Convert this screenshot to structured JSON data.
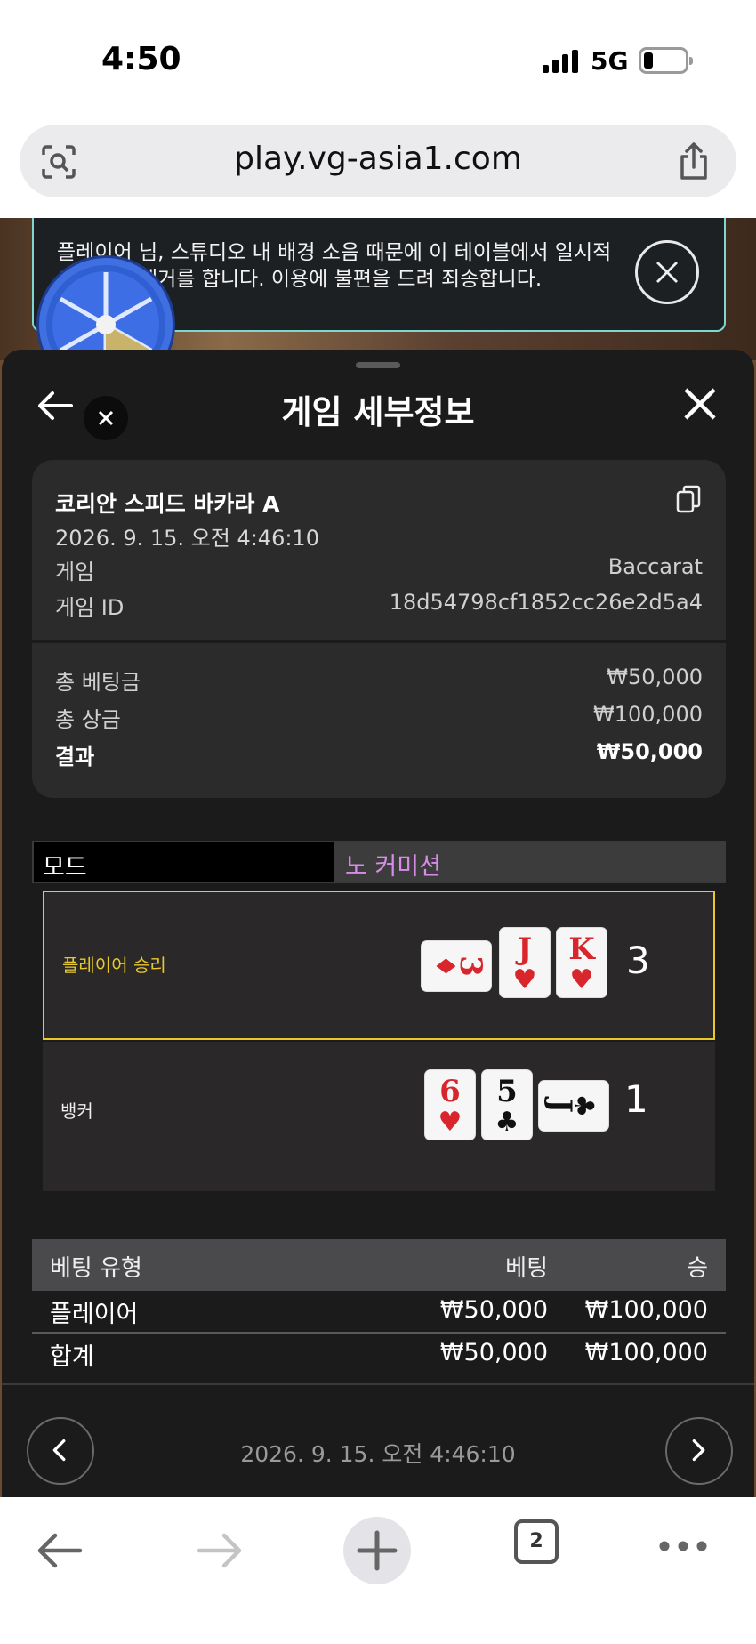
{
  "status_bar": {
    "time": "4:50",
    "network": "5G"
  },
  "browser": {
    "url": "play.vg-asia1.com",
    "tab_count": "2"
  },
  "notice": {
    "text": "플레이어 님, 스튜디오 내 배경 소음 때문에 이 테이블에서 일시적으로 소음제거를 합니다. 이용에 불편을 드려 죄송합니다."
  },
  "sheet": {
    "title": "게임 세부정보",
    "game_name": "코리안 스피드 바카라 A",
    "datetime": "2026. 9. 15. 오전 4:46:10",
    "rows": [
      {
        "label": "게임",
        "value": "Baccarat"
      },
      {
        "label": "게임 ID",
        "value": "18d54798cf1852cc26e2d5a4"
      }
    ],
    "totals": [
      {
        "label": "총 베팅금",
        "value": "₩50,000"
      },
      {
        "label": "총 상금",
        "value": "₩100,000"
      },
      {
        "label": "결과",
        "value": "₩50,000"
      }
    ],
    "mode_label": "모드",
    "mode_value": "노 커미션",
    "player": {
      "label": "플레이어 승리",
      "score": "3",
      "cards": [
        {
          "rank": "3",
          "suit": "♦",
          "color": "red",
          "rotated": true
        },
        {
          "rank": "J",
          "suit": "♥",
          "color": "red"
        },
        {
          "rank": "K",
          "suit": "♥",
          "color": "red"
        }
      ]
    },
    "banker": {
      "label": "뱅커",
      "score": "1",
      "cards": [
        {
          "rank": "6",
          "suit": "♥",
          "color": "red"
        },
        {
          "rank": "5",
          "suit": "♣",
          "color": "black"
        },
        {
          "rank": "J",
          "suit": "♣",
          "color": "black",
          "rotated": true
        }
      ]
    },
    "bet_table": {
      "headers": [
        "베팅 유형",
        "베팅",
        "승"
      ],
      "rows": [
        {
          "type": "플레이어",
          "bet": "₩50,000",
          "win": "₩100,000"
        },
        {
          "type": "합계",
          "bet": "₩50,000",
          "win": "₩100,000"
        }
      ]
    },
    "footer_datetime": "2026. 9. 15. 오전 4:46:10"
  },
  "colors": {
    "win_border": "#e9c82a",
    "mode_accent": "#d88be8",
    "notice_border": "#7fd8d0",
    "card_red": "#d8262c"
  }
}
